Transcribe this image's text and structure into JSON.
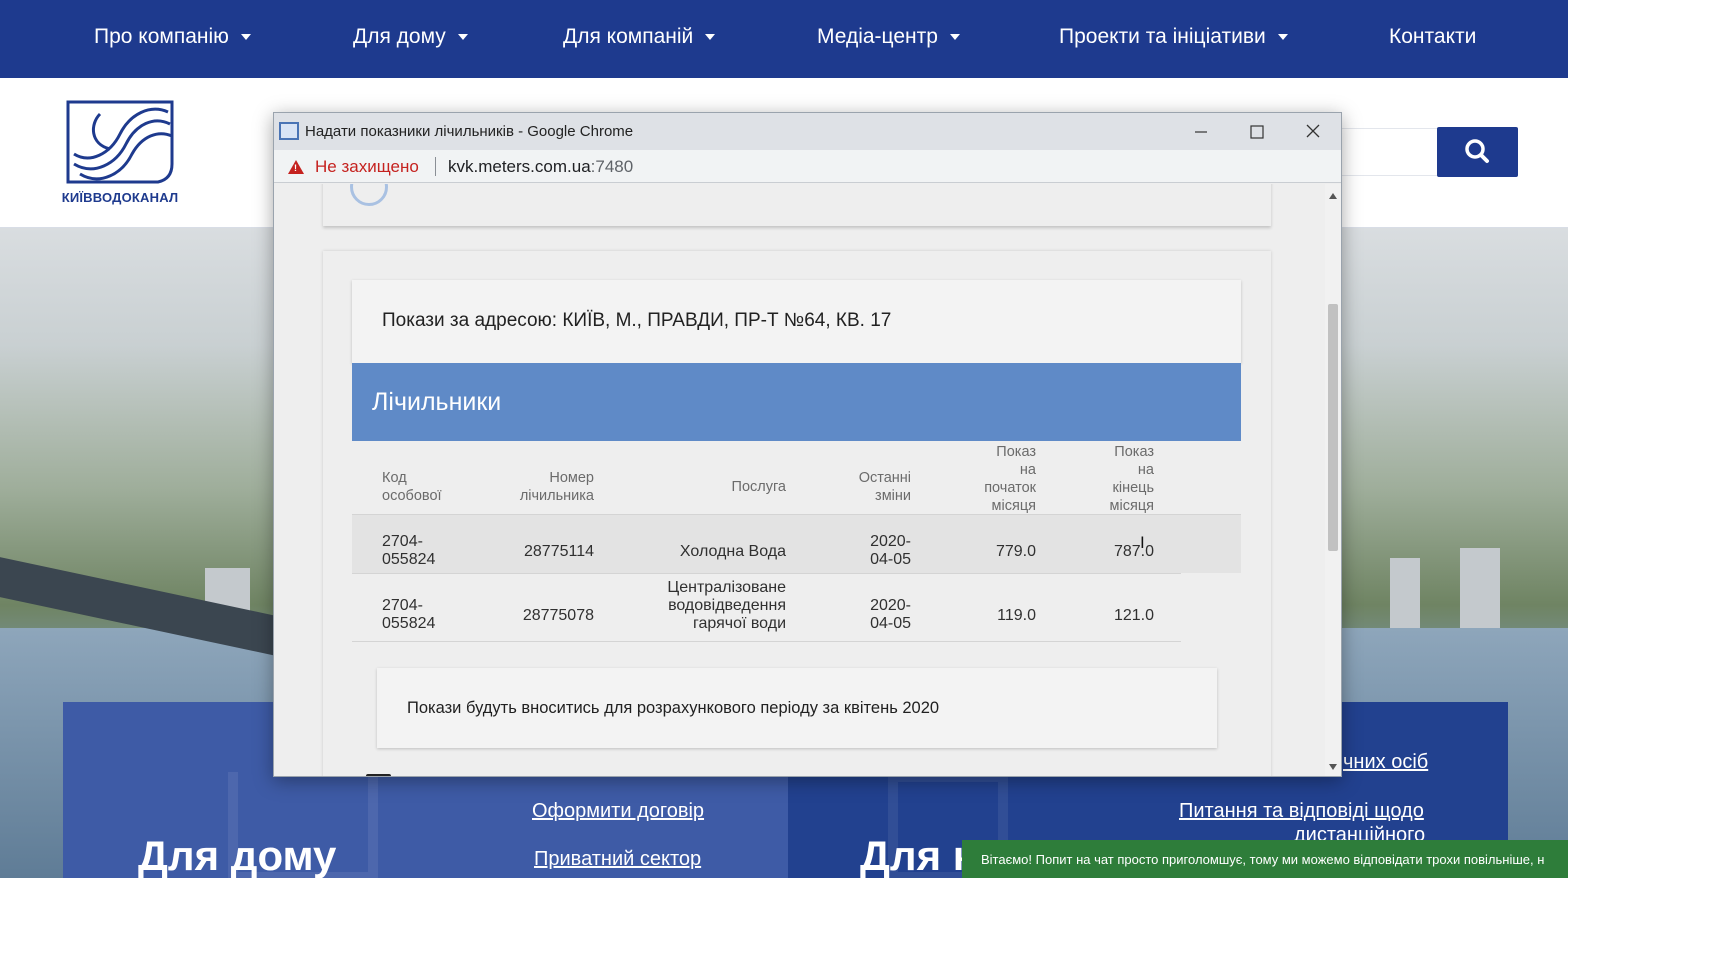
{
  "nav": {
    "items": [
      {
        "label": "Про компанію",
        "has_dropdown": true
      },
      {
        "label": "Для дому",
        "has_dropdown": true
      },
      {
        "label": "Для компаній",
        "has_dropdown": true
      },
      {
        "label": "Медіа-центр",
        "has_dropdown": true
      },
      {
        "label": "Проекти та ініціативи",
        "has_dropdown": true
      },
      {
        "label": "Контакти",
        "has_dropdown": false
      }
    ]
  },
  "header": {
    "logo_text": "КИЇВВОДОКАНАЛ",
    "search_icon": "search-icon"
  },
  "panels": {
    "home": {
      "title": "Для дому",
      "links": [
        "Оформити договір",
        "Приватний сектор"
      ]
    },
    "business": {
      "title": "Для к",
      "links": [
        "чних осіб",
        "Питання та відповіді щодо",
        "дистанційного"
      ]
    }
  },
  "chat": {
    "text": "Вітаємо! Попит на чат просто приголомшує, тому ми можемо відповідати трохи повільніше, н"
  },
  "popup": {
    "window_title": "Надати показники лічильників - Google Chrome",
    "security_label": "Не захищено",
    "url_host": "kvk.meters.com.ua",
    "url_port": ":7480",
    "address_heading": "Покази за адресою: КИЇВ, М., ПРАВДИ, ПР-Т №64, КВ. 17",
    "meters_title": "Лічильники",
    "table": {
      "headers": [
        [
          "Код",
          "особової"
        ],
        [
          "Номер",
          "лічильника"
        ],
        [
          "Послуга"
        ],
        [
          "Останні",
          "зміни"
        ],
        [
          "Показ",
          "на",
          "початок",
          "місяця"
        ],
        [
          "Показ",
          "на",
          "кінець",
          "місяця"
        ]
      ],
      "rows": [
        {
          "account": [
            "2704-",
            "055824"
          ],
          "meter": "28775114",
          "service": [
            "Холодна Вода"
          ],
          "changed": [
            "2020-",
            "04-05"
          ],
          "start": "779.0",
          "end": "787.0"
        },
        {
          "account": [
            "2704-",
            "055824"
          ],
          "meter": "28775078",
          "service": [
            "Централізоване",
            "водовідведення",
            "гарячої води"
          ],
          "changed": [
            "2020-",
            "04-05"
          ],
          "start": "119.0",
          "end": "121.0"
        }
      ]
    },
    "note": "Покази будуть вноситись для розрахункового періоду за квітень 2020"
  },
  "colors": {
    "nav_bg": "#1e3a8e",
    "meters_header": "#5f8ac7",
    "chat_bg": "#2e7d3a",
    "insecure": "#c5221f"
  }
}
